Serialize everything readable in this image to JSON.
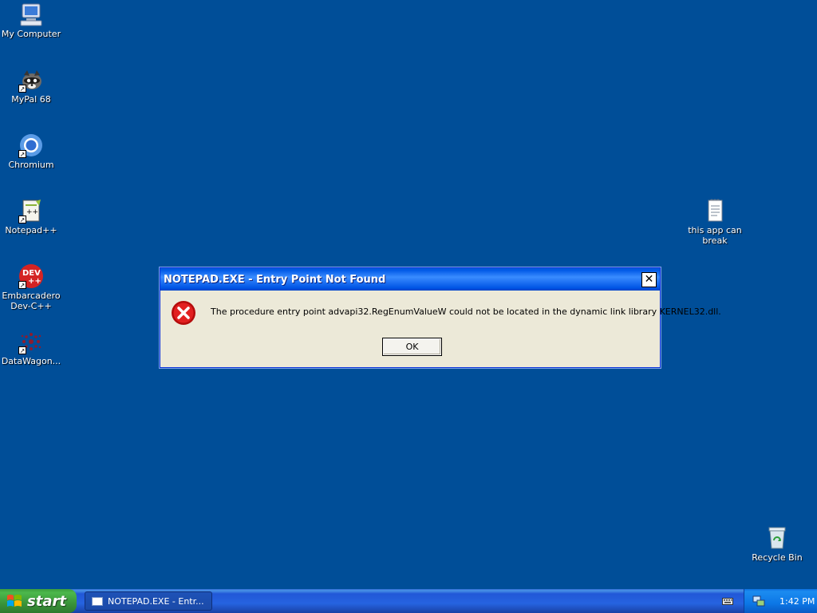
{
  "desktop": {
    "background_color": "#004E98",
    "icons": [
      {
        "label": "My Computer",
        "icon": "my-computer-icon"
      },
      {
        "label": "MyPal 68",
        "icon": "mypal-icon"
      },
      {
        "label": "Chromium",
        "icon": "chromium-icon"
      },
      {
        "label": "Notepad++",
        "icon": "notepad-plus-plus-icon"
      },
      {
        "label": "Embarcadero Dev-C++",
        "icon": "dev-cpp-icon",
        "badge": "DEV ++"
      },
      {
        "label": "DataWagon...",
        "icon": "datawagon-icon"
      },
      {
        "label": "this app can break",
        "icon": "text-file-icon"
      },
      {
        "label": "Recycle Bin",
        "icon": "recycle-bin-icon"
      }
    ]
  },
  "dialog": {
    "title": "NOTEPAD.EXE - Entry Point Not Found",
    "message": "The procedure entry point advapi32.RegEnumValueW could not be located in the dynamic link library KERNEL32.dll.",
    "ok_label": "OK",
    "close_glyph": "✕",
    "icon": "error-icon",
    "accent_color": "#0058E6"
  },
  "taskbar": {
    "start_label": "start",
    "task_label": "NOTEPAD.EXE - Entr...",
    "clock": "1:42 PM"
  }
}
